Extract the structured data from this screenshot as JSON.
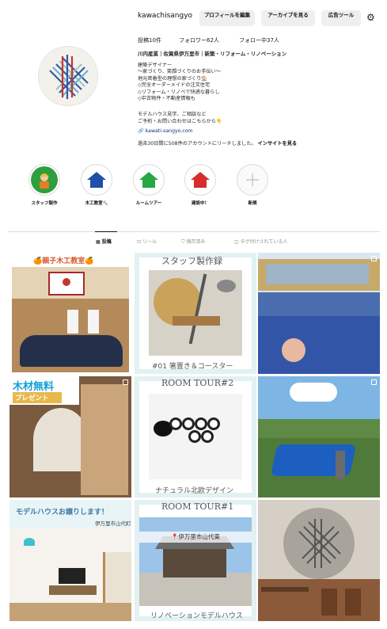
{
  "profile": {
    "username": "kawachisangyo",
    "buttons": {
      "edit_profile": "プロフィールを編集",
      "view_archive": "アーカイブを見る",
      "ad_tools": "広告ツール"
    },
    "stats": {
      "posts": "投稿10件",
      "followers": "フォロワー62人",
      "following": "フォロー中37人"
    },
    "bio": {
      "name_line": "川内産業｜佐賀県伊万里市｜新築・リフォーム・リノベーション",
      "lines": [
        "建築デザイナー",
        "〜家づくり、笑顔づくりのお手伝い〜",
        "地元密着型の理想の家づくり🏠",
        "◇完全オーダーメイドの注文住宅",
        "◇リフォーム・リノベで快適な暮らし",
        "◇中古物件・不動産情報も",
        "",
        "モデルハウス見学、ご相談など",
        "ご予約・お問い合わせはこちらから👇"
      ],
      "link": "kawati-sangyo.com"
    },
    "reach": {
      "text": "過去30日間に508件のアカウントにリーチしました。",
      "insight": "インサイトを見る"
    }
  },
  "highlights": [
    {
      "label": "スタッフ製作",
      "color": "#2e9e3e"
    },
    {
      "label": "木工教室🔨",
      "color": "#1f4fa8"
    },
    {
      "label": "ルームツアー",
      "color": "#28a745"
    },
    {
      "label": "建設中！",
      "color": "#d62d2d"
    },
    {
      "label": "新規",
      "color": "#c7c7c7"
    }
  ],
  "tabs": [
    "投稿",
    "リール",
    "保存済み",
    "タグ付けされている人"
  ],
  "posts": {
    "p1": {
      "title": "🍊親子木工教室🍊"
    },
    "p2": {
      "title": "スタッフ製作録",
      "caption": "#01 箸置き＆コースター"
    },
    "p4": {
      "title1": "木材無料",
      "title2": "プレゼント"
    },
    "p5": {
      "title": "ROOM TOUR#2",
      "caption": "ナチュラル北欧デザイン"
    },
    "p7": {
      "title": "モデルハウスお譲りします！",
      "sub": "伊万里市山代町"
    },
    "p8": {
      "title": "ROOM TOUR#1",
      "pin": "伊万里市山代東",
      "caption": "リノベーションモデルハウス"
    }
  },
  "colors": {
    "accent_link": "#00376b",
    "tab_inactive": "#8e8e8e",
    "teal": "#7ccfcf"
  }
}
